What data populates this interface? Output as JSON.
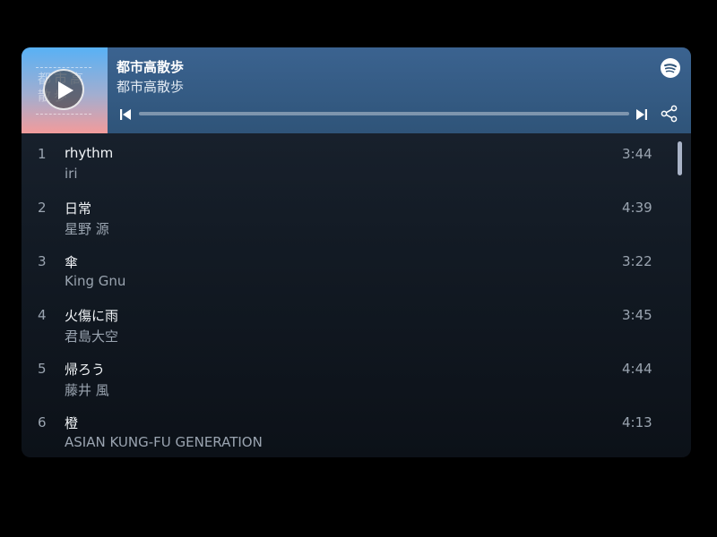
{
  "header": {
    "album_title": "都市高散歩",
    "artist": "都市高散歩",
    "cover_text": "都市高散歩",
    "progress_percent": 0,
    "brand_color": "#1DB954"
  },
  "icons": {
    "play": "play-icon",
    "prev": "skip-previous-icon",
    "next": "skip-next-icon",
    "share": "share-icon",
    "logo": "spotify-logo-icon"
  },
  "tracks": [
    {
      "num": "1",
      "title": "rhythm",
      "artist": "iri",
      "duration": "3:44"
    },
    {
      "num": "2",
      "title": "日常",
      "artist": "星野 源",
      "duration": "4:39"
    },
    {
      "num": "3",
      "title": "傘",
      "artist": "King Gnu",
      "duration": "3:22"
    },
    {
      "num": "4",
      "title": "火傷に雨",
      "artist": "君島大空",
      "duration": "3:45"
    },
    {
      "num": "5",
      "title": "帰ろう",
      "artist": "藤井 風",
      "duration": "4:44"
    },
    {
      "num": "6",
      "title": "橙",
      "artist": "ASIAN KUNG-FU GENERATION",
      "duration": "4:13"
    }
  ]
}
